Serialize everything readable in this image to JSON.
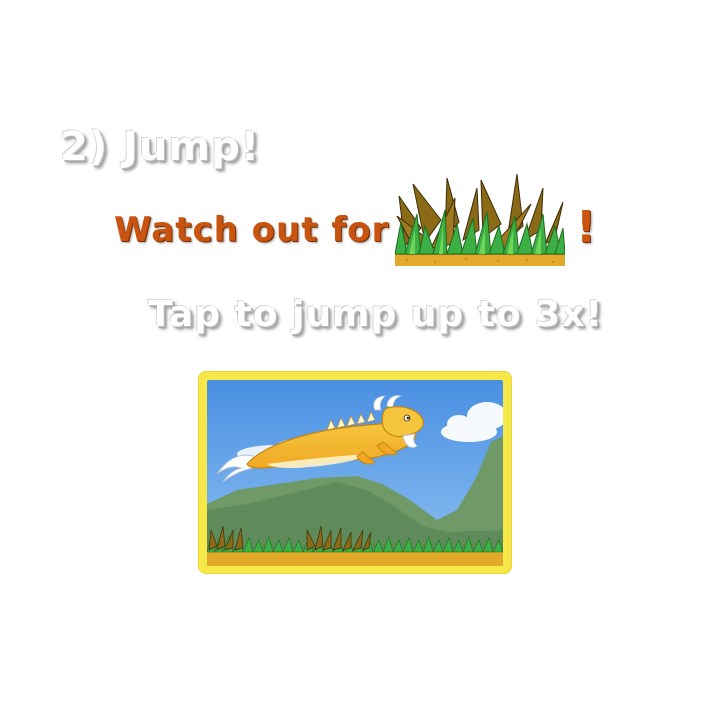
{
  "tutorial": {
    "step_title": "2) Jump!",
    "warning_text": "Watch out for",
    "warning_exclaim": "!",
    "instruction": "Tap to jump up to 3x!"
  },
  "icons": {
    "hazard": "thorny-bush-icon",
    "player": "iguana-character"
  },
  "colors": {
    "warning_text": "#c9540f",
    "frame": "#f7e84a",
    "sky": "#5b9be6",
    "grass": "#3cb044",
    "ground": "#e2b13a",
    "character": "#f5c23a"
  }
}
